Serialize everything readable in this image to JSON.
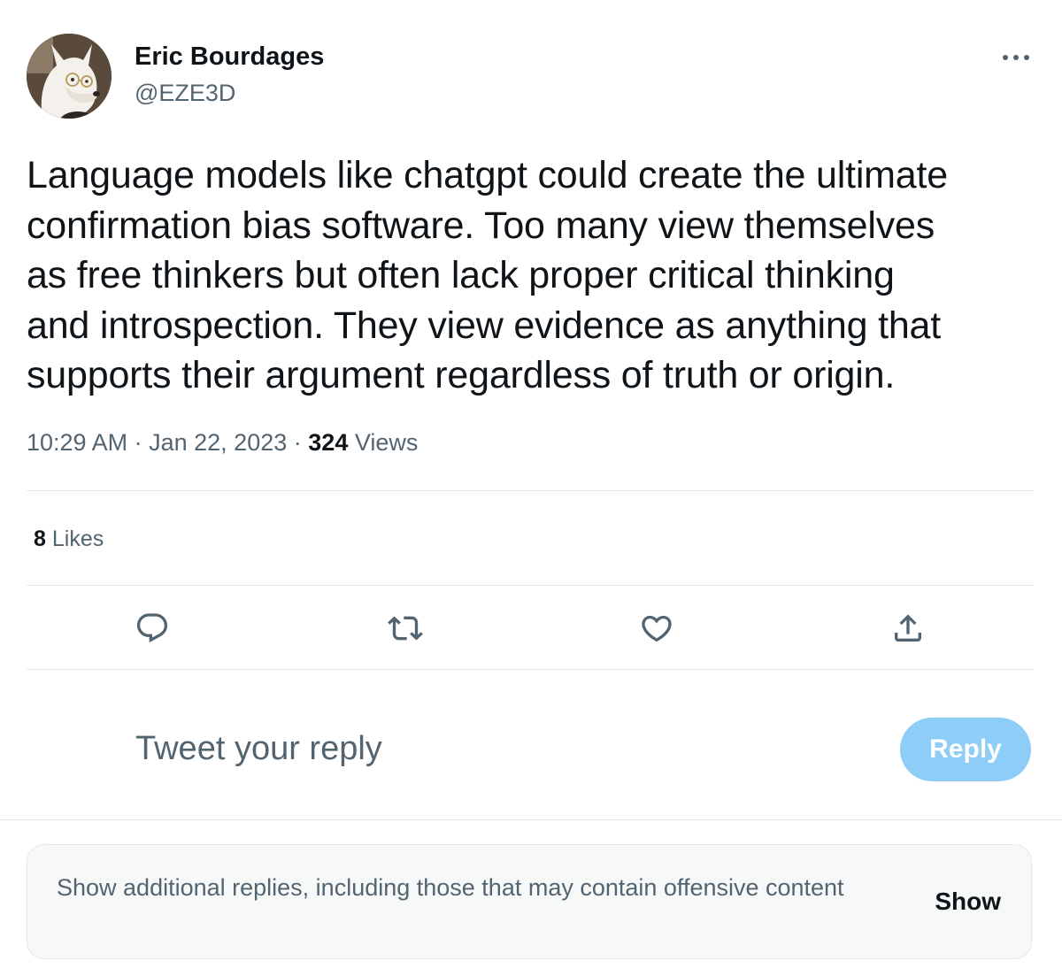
{
  "author": {
    "name": "Eric Bourdages",
    "handle": "@EZE3D",
    "avatar_icon": "dog-avatar"
  },
  "tweet": {
    "text": "Language models like chatgpt could create the ultimate\nconfirmation bias software. Too many view themselves\nas free thinkers but often lack proper critical thinking\nand introspection. They view evidence as anything that\nsupports their argument regardless of truth or origin.",
    "time": "10:29 AM",
    "separator": "·",
    "date": "Jan 22, 2023",
    "views_count": "324",
    "views_label": "Views"
  },
  "stats": {
    "likes_count": "8",
    "likes_label": "Likes"
  },
  "actions": [
    {
      "name": "reply-icon"
    },
    {
      "name": "retweet-icon"
    },
    {
      "name": "like-icon"
    },
    {
      "name": "share-icon"
    }
  ],
  "reply_box": {
    "placeholder": "Tweet your reply",
    "button_label": "Reply"
  },
  "notice": {
    "text": "Show additional replies, including those that may contain offensive content",
    "button_label": "Show"
  },
  "colors": {
    "text_primary": "#0f1419",
    "text_secondary": "#536471",
    "reply_button_disabled": "#8ecdf8",
    "icon": "#536471"
  }
}
